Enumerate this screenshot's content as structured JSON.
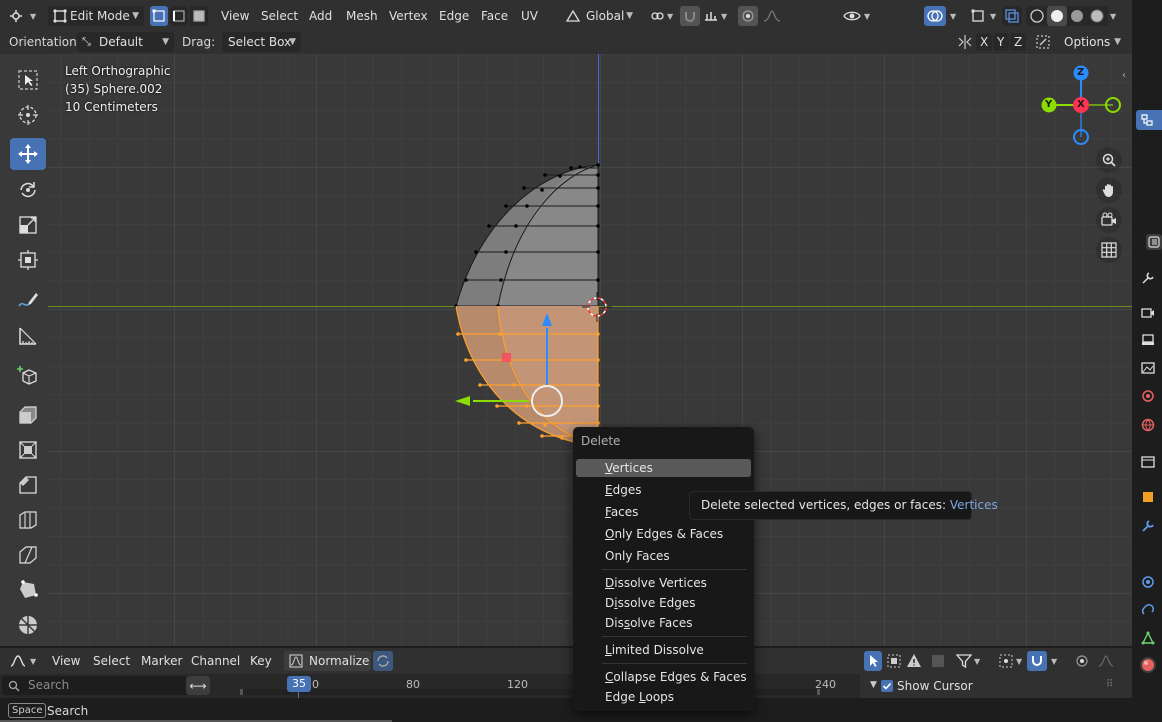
{
  "header": {
    "mode": "Edit Mode",
    "menus": [
      "View",
      "Select",
      "Add",
      "Mesh",
      "Vertex",
      "Edge",
      "Face",
      "UV"
    ],
    "transform_orientation": "Global"
  },
  "tool_header": {
    "orientation_label": "Orientation:",
    "orientation_value": "Default",
    "drag_label": "Drag:",
    "drag_value": "Select Box",
    "axes": [
      "X",
      "Y",
      "Z"
    ],
    "options": "Options"
  },
  "viewport": {
    "view_name": "Left Orthographic",
    "object": "(35) Sphere.002",
    "scale": "10 Centimeters",
    "gizmo": {
      "z": "Z",
      "x": "X",
      "y": "Y"
    },
    "colors": {
      "background": "#393939",
      "x_axis": "#ff3352",
      "y_axis": "#8bdc00",
      "z_axis": "#2b8cff",
      "selection": "#ffa02e"
    }
  },
  "context_menu": {
    "title": "Delete",
    "items": [
      {
        "label": "Vertices",
        "u": "V",
        "rest": "ertices"
      },
      {
        "label": "Edges",
        "u": "E",
        "rest": "dges"
      },
      {
        "label": "Faces",
        "u": "F",
        "rest": "aces"
      },
      {
        "label": "Only Edges & Faces",
        "u": "O",
        "rest": "nly Edges & Faces"
      },
      {
        "label": "Only Faces",
        "u": "",
        "rest": "Only Faces"
      },
      {
        "label": "Dissolve Vertices",
        "u": "D",
        "rest": "issolve Vertices"
      },
      {
        "label": "Dissolve Edges",
        "pre": "D",
        "u": "i",
        "rest": "ssolve Edges"
      },
      {
        "label": "Dissolve Faces",
        "pre": "Dis",
        "u": "s",
        "rest": "olve Faces"
      },
      {
        "label": "Limited Dissolve",
        "u": "L",
        "rest": "imited Dissolve"
      },
      {
        "label": "Collapse Edges & Faces",
        "u": "C",
        "rest": "ollapse Edges & Faces"
      },
      {
        "label": "Edge Loops",
        "pre": "Edge ",
        "u": "L",
        "rest": "oops"
      }
    ]
  },
  "tooltip": {
    "text": "Delete selected vertices, edges or faces:",
    "value": "Vertices"
  },
  "timeline": {
    "menus": [
      "View",
      "Select",
      "Marker",
      "Channel",
      "Key"
    ],
    "normalize": "Normalize",
    "current_frame": "35",
    "ticks": [
      "0",
      "80",
      "120",
      "240"
    ],
    "search_placeholder": "Search",
    "show_cursor": "Show Cursor"
  },
  "statusbar": {
    "key": "Space",
    "action": "Search"
  }
}
